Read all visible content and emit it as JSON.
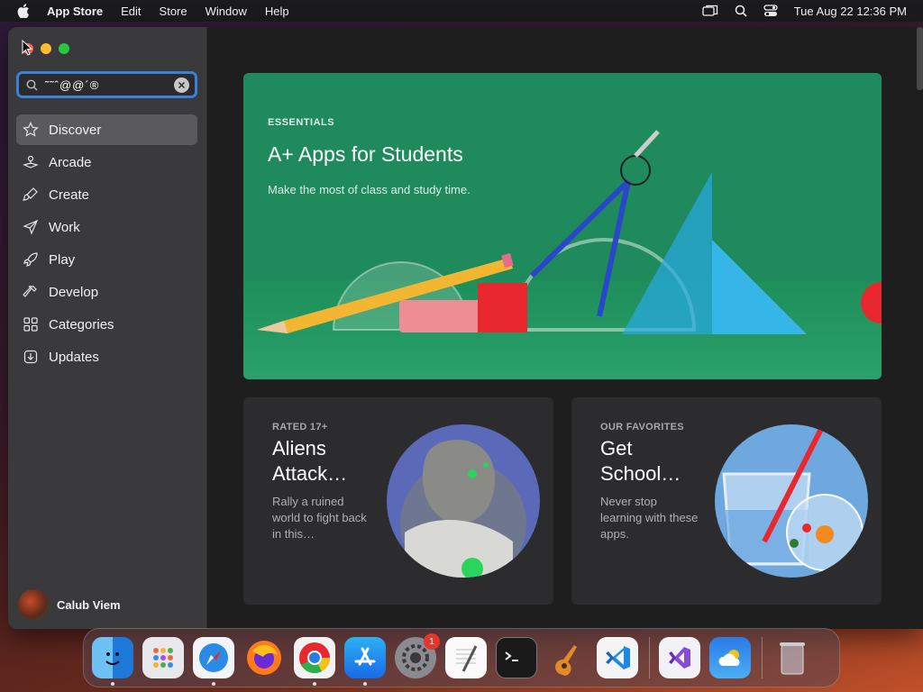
{
  "menubar": {
    "app_name": "App Store",
    "items": [
      "Edit",
      "Store",
      "Window",
      "Help"
    ],
    "clock": "Tue Aug 22  12:36 PM"
  },
  "search": {
    "value": "˜˜ˆ@@´®"
  },
  "sidebar": {
    "items": [
      {
        "label": "Discover",
        "icon": "star-icon",
        "active": true
      },
      {
        "label": "Arcade",
        "icon": "joystick-icon"
      },
      {
        "label": "Create",
        "icon": "paintbrush-icon"
      },
      {
        "label": "Work",
        "icon": "paperplane-icon"
      },
      {
        "label": "Play",
        "icon": "rocket-icon"
      },
      {
        "label": "Develop",
        "icon": "hammer-icon"
      },
      {
        "label": "Categories",
        "icon": "grid-icon"
      },
      {
        "label": "Updates",
        "icon": "download-icon"
      }
    ],
    "user_name": "Calub Viem"
  },
  "hero": {
    "eyebrow": "ESSENTIALS",
    "title": "A+ Apps for Students",
    "subtitle": "Make the most of class and study time."
  },
  "cards": [
    {
      "eyebrow": "RATED 17+",
      "title": "Aliens Attack…",
      "desc": "Rally a ruined world to fight back in this…"
    },
    {
      "eyebrow": "OUR FAVORITES",
      "title": "Get School…",
      "desc": "Never stop learning with these apps."
    }
  ],
  "dock": {
    "apps": [
      "finder-icon",
      "launchpad-icon",
      "safari-icon",
      "firefox-icon",
      "chrome-icon",
      "app-store-icon",
      "system-settings-icon",
      "textedit-icon",
      "terminal-icon",
      "garageband-icon",
      "vscode-icon",
      "visual-studio-icon",
      "weather-icon",
      "trash-icon"
    ],
    "settings_badge": "1"
  },
  "colors": {
    "accent": "#3b82d6",
    "hero_green": "#1f8a5c"
  }
}
